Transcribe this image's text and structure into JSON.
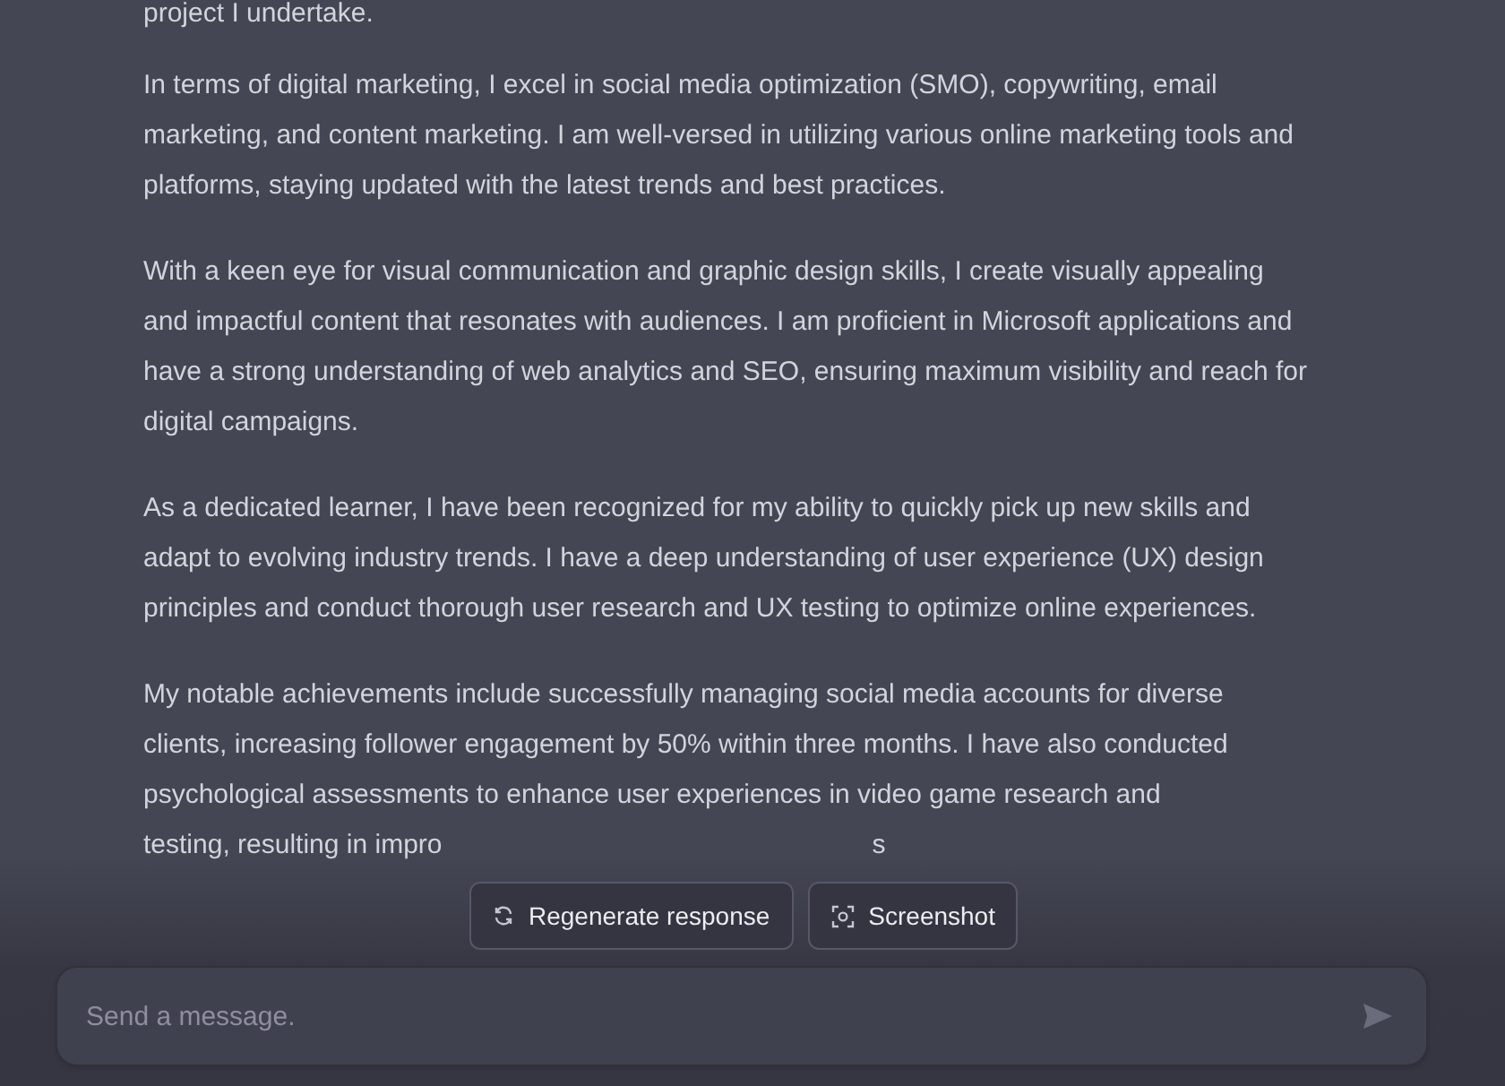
{
  "message": {
    "paragraphs": [
      "project I undertake.",
      "In terms of digital marketing, I excel in social media optimization (SMO), copywriting, email marketing, and content marketing. I am well-versed in utilizing various online marketing tools and platforms, staying updated with the latest trends and best practices.",
      "With a keen eye for visual communication and graphic design skills, I create visually appealing and impactful content that resonates with audiences. I am proficient in Microsoft applications and have a strong understanding of web analytics and SEO, ensuring maximum visibility and reach for digital campaigns.",
      "As a dedicated learner, I have been recognized for my ability to quickly pick up new skills and adapt to evolving industry trends. I have a deep understanding of user experience (UX) design principles and conduct thorough user research and UX testing to optimize online experiences.",
      "My notable achievements include successfully managing social media accounts for diverse clients, increasing follower engagement by 50% within three months. I have also conducted psychological assessments to enhance user experiences in video game research and"
    ],
    "covered_line_fragments": [
      "testing, resulting in impro",
      "s"
    ]
  },
  "actions": [
    {
      "kind": "regenerate",
      "label": "Regenerate response"
    },
    {
      "kind": "screenshot",
      "label": "Screenshot"
    }
  ],
  "composer": {
    "placeholder": "Send a message."
  }
}
